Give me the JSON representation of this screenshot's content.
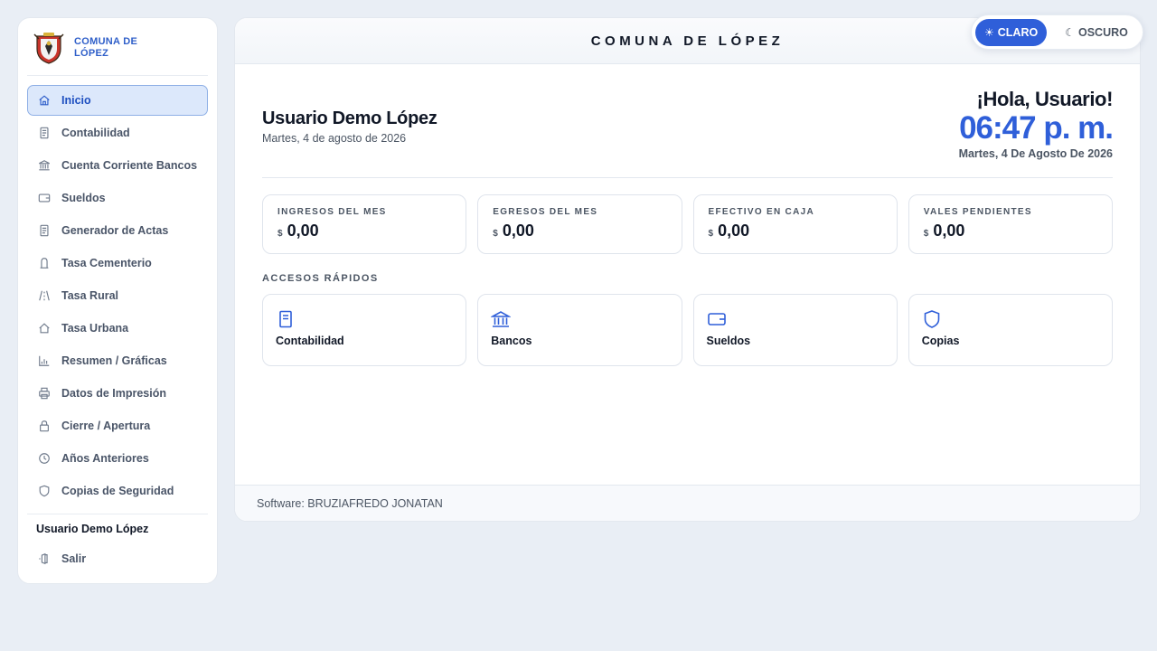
{
  "brand": {
    "name": "COMUNA DE LÓPEZ"
  },
  "sidebar": {
    "items": [
      {
        "label": "Inicio",
        "icon": "home-icon",
        "active": true
      },
      {
        "label": "Contabilidad",
        "icon": "document-icon"
      },
      {
        "label": "Cuenta Corriente Bancos",
        "icon": "bank-icon"
      },
      {
        "label": "Sueldos",
        "icon": "wallet-icon"
      },
      {
        "label": "Generador de Actas",
        "icon": "document-icon"
      },
      {
        "label": "Tasa Cementerio",
        "icon": "tombstone-icon"
      },
      {
        "label": "Tasa Rural",
        "icon": "road-icon"
      },
      {
        "label": "Tasa Urbana",
        "icon": "house-icon"
      },
      {
        "label": "Resumen / Gráficas",
        "icon": "bar-chart-icon"
      },
      {
        "label": "Datos de Impresión",
        "icon": "printer-icon"
      },
      {
        "label": "Cierre / Apertura",
        "icon": "lock-icon"
      },
      {
        "label": "Años Anteriores",
        "icon": "clock-icon"
      },
      {
        "label": "Copias de Seguridad",
        "icon": "shield-icon"
      }
    ],
    "user_name": "Usuario Demo López",
    "logout_label": "Salir"
  },
  "header": {
    "title": "COMUNA DE LÓPEZ"
  },
  "theme": {
    "light_label": "CLARO",
    "dark_label": "OSCURO",
    "active": "light"
  },
  "hero": {
    "name": "Usuario Demo López",
    "date": "Martes, 4 de agosto de 2026",
    "greeting": "¡Hola, Usuario!",
    "time": "06:47 p. m.",
    "date_long": "Martes, 4 De Agosto De 2026"
  },
  "stats": [
    {
      "label": "INGRESOS DEL MES",
      "currency": "$",
      "value": "0,00"
    },
    {
      "label": "EGRESOS DEL MES",
      "currency": "$",
      "value": "0,00"
    },
    {
      "label": "EFECTIVO EN CAJA",
      "currency": "$",
      "value": "0,00"
    },
    {
      "label": "VALES PENDIENTES",
      "currency": "$",
      "value": "0,00"
    }
  ],
  "quick_access": {
    "title": "ACCESOS RÁPIDOS",
    "items": [
      {
        "label": "Contabilidad",
        "icon": "document-icon"
      },
      {
        "label": "Bancos",
        "icon": "bank-icon"
      },
      {
        "label": "Sueldos",
        "icon": "wallet-icon"
      },
      {
        "label": "Copias",
        "icon": "shield-icon"
      }
    ]
  },
  "footer": {
    "text": "Software: BRUZIAFREDO JONATAN"
  },
  "colors": {
    "accent": "#2f5fd9",
    "active_bg": "#dce8fb",
    "page_bg": "#e9eef5"
  }
}
